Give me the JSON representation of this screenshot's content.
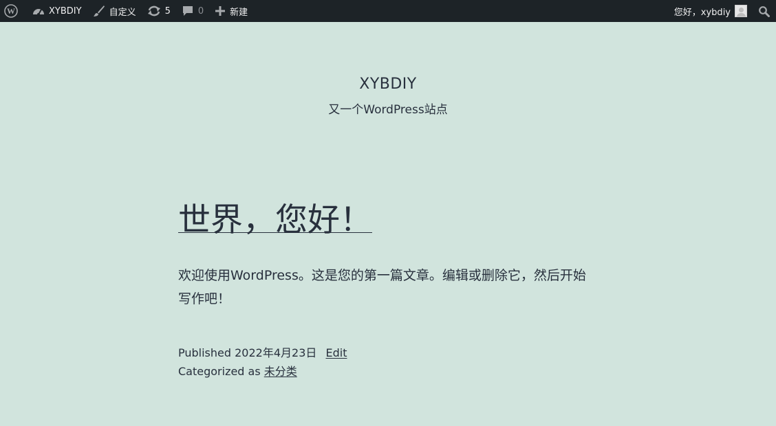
{
  "adminbar": {
    "site_name": "XYBDIY",
    "customize_label": "自定义",
    "updates_count": "5",
    "comments_count": "0",
    "new_label": "新建",
    "greeting": "您好，xybdiy",
    "icons": [
      "wordpress-logo-icon",
      "dashboard-icon",
      "brush-icon",
      "update-icon",
      "comment-icon",
      "plus-icon",
      "avatar",
      "search-icon"
    ]
  },
  "site": {
    "title": "XYBDIY",
    "description": "又一个WordPress站点"
  },
  "post": {
    "title": "世界，您好！",
    "body": "欢迎使用WordPress。这是您的第一篇文章。编辑或删除它，然后开始写作吧！",
    "published_prefix": "Published",
    "published_date": "2022年4月23日",
    "edit_label": "Edit",
    "categorized_prefix": "Categorized as",
    "category": "未分类"
  },
  "colors": {
    "adminbar_bg": "#1d2327",
    "page_bg": "#d1e4dd",
    "text": "#28303d"
  }
}
